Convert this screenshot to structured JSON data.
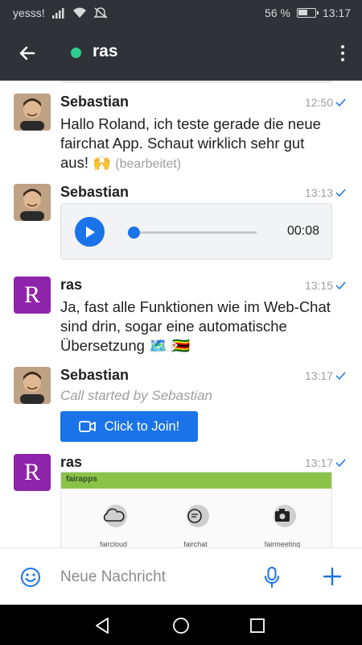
{
  "status_bar": {
    "carrier": "yesss!",
    "battery_percent": "56 %",
    "battery_level": 0.56,
    "clock": "13:17",
    "icons": [
      "signal-icon",
      "wifi-icon",
      "mute-icon",
      "battery-icon"
    ]
  },
  "header": {
    "back_icon": "arrow-left-icon",
    "title": "ras",
    "presence_color": "#2ecc8f",
    "menu_icon": "more-vertical-icon"
  },
  "messages": [
    {
      "sender": "Sebastian",
      "time": "12:50",
      "text": "Hallo Roland, ich teste gerade die neue fairchat App. Schaut wirklich sehr gut aus! 🙌",
      "edited_label": "(bearbeitet)"
    },
    {
      "sender": "Sebastian",
      "time": "13:13",
      "audio_duration": "00:08",
      "audio_progress": 0.03
    },
    {
      "sender": "ras",
      "avatar_letter": "R",
      "time": "13:15",
      "text": "Ja, fast alle Funktionen wie im Web-Chat sind drin, sogar eine automatische Übersetzung 🗺️ 🇿🇼"
    },
    {
      "sender": "Sebastian",
      "time": "13:17",
      "note": "Call started by Sebastian",
      "button_label": "Click to Join!"
    },
    {
      "sender": "ras",
      "avatar_letter": "R",
      "time": "13:17",
      "preview": {
        "brand": "fairapps",
        "apps": [
          "faircloud",
          "fairchat",
          "fairmeeting"
        ]
      }
    }
  ],
  "composer": {
    "placeholder": "Neue Nachricht",
    "icons": [
      "emoji-icon",
      "microphone-icon",
      "plus-icon"
    ]
  },
  "colors": {
    "app_bar": "#2f3337",
    "accent": "#1a73e8",
    "avatar_ras": "#8e24aa",
    "preview_bar": "#8bc34a"
  }
}
